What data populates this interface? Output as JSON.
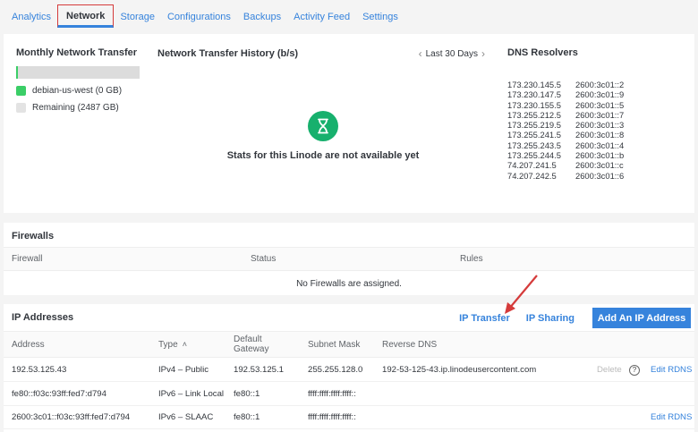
{
  "tabs": [
    {
      "label": "Analytics"
    },
    {
      "label": "Network",
      "active": true
    },
    {
      "label": "Storage"
    },
    {
      "label": "Configurations"
    },
    {
      "label": "Backups"
    },
    {
      "label": "Activity Feed"
    },
    {
      "label": "Settings"
    }
  ],
  "monthly": {
    "title": "Monthly Network Transfer",
    "used_fraction": 0.0,
    "legend": [
      {
        "label": "debian-us-west (0 GB)",
        "color": "#3bce67"
      },
      {
        "label": "Remaining (2487 GB)",
        "color": "#e3e3e3"
      }
    ]
  },
  "history": {
    "title": "Network Transfer History (b/s)",
    "range_label": "Last 30 Days",
    "empty_message": "Stats for this Linode are not available yet",
    "icon": "hourglass-icon",
    "icon_color": "#17b06d"
  },
  "dns": {
    "title": "DNS Resolvers",
    "ipv4": [
      "173.230.145.5",
      "173.230.147.5",
      "173.230.155.5",
      "173.255.212.5",
      "173.255.219.5",
      "173.255.241.5",
      "173.255.243.5",
      "173.255.244.5",
      "74.207.241.5",
      "74.207.242.5"
    ],
    "ipv6": [
      "2600:3c01::2",
      "2600:3c01::9",
      "2600:3c01::5",
      "2600:3c01::7",
      "2600:3c01::3",
      "2600:3c01::8",
      "2600:3c01::4",
      "2600:3c01::b",
      "2600:3c01::c",
      "2600:3c01::6"
    ]
  },
  "firewalls": {
    "title": "Firewalls",
    "columns": [
      "Firewall",
      "Status",
      "Rules"
    ],
    "empty_message": "No Firewalls are assigned."
  },
  "ip_addresses": {
    "title": "IP Addresses",
    "transfer_label": "IP Transfer",
    "sharing_label": "IP Sharing",
    "add_label": "Add An IP Address",
    "columns": {
      "address": "Address",
      "type": "Type",
      "sort_icon": "chevron-up-icon",
      "gateway_line1": "Default",
      "gateway_line2": "Gateway",
      "subnet": "Subnet Mask",
      "rdns": "Reverse DNS"
    },
    "rows": [
      {
        "address": "192.53.125.43",
        "type": "IPv4 – Public",
        "gateway": "192.53.125.1",
        "subnet": "255.255.128.0",
        "rdns": "192-53-125-43.ip.linodeusercontent.com",
        "delete": "Delete",
        "edit": "Edit RDNS"
      },
      {
        "address": "fe80::f03c:93ff:fed7:d794",
        "type": "IPv6 – Link Local",
        "gateway": "fe80::1",
        "subnet": "ffff:ffff:ffff:ffff::",
        "rdns": "",
        "delete": "",
        "edit": ""
      },
      {
        "address": "2600:3c01::f03c:93ff:fed7:d794",
        "type": "IPv6 – SLAAC",
        "gateway": "fe80::1",
        "subnet": "ffff:ffff:ffff:ffff::",
        "rdns": "",
        "delete": "",
        "edit": "Edit RDNS"
      }
    ]
  },
  "colors": {
    "accent": "#3683dc",
    "annotation": "#d53b3b",
    "success": "#3bce67"
  }
}
